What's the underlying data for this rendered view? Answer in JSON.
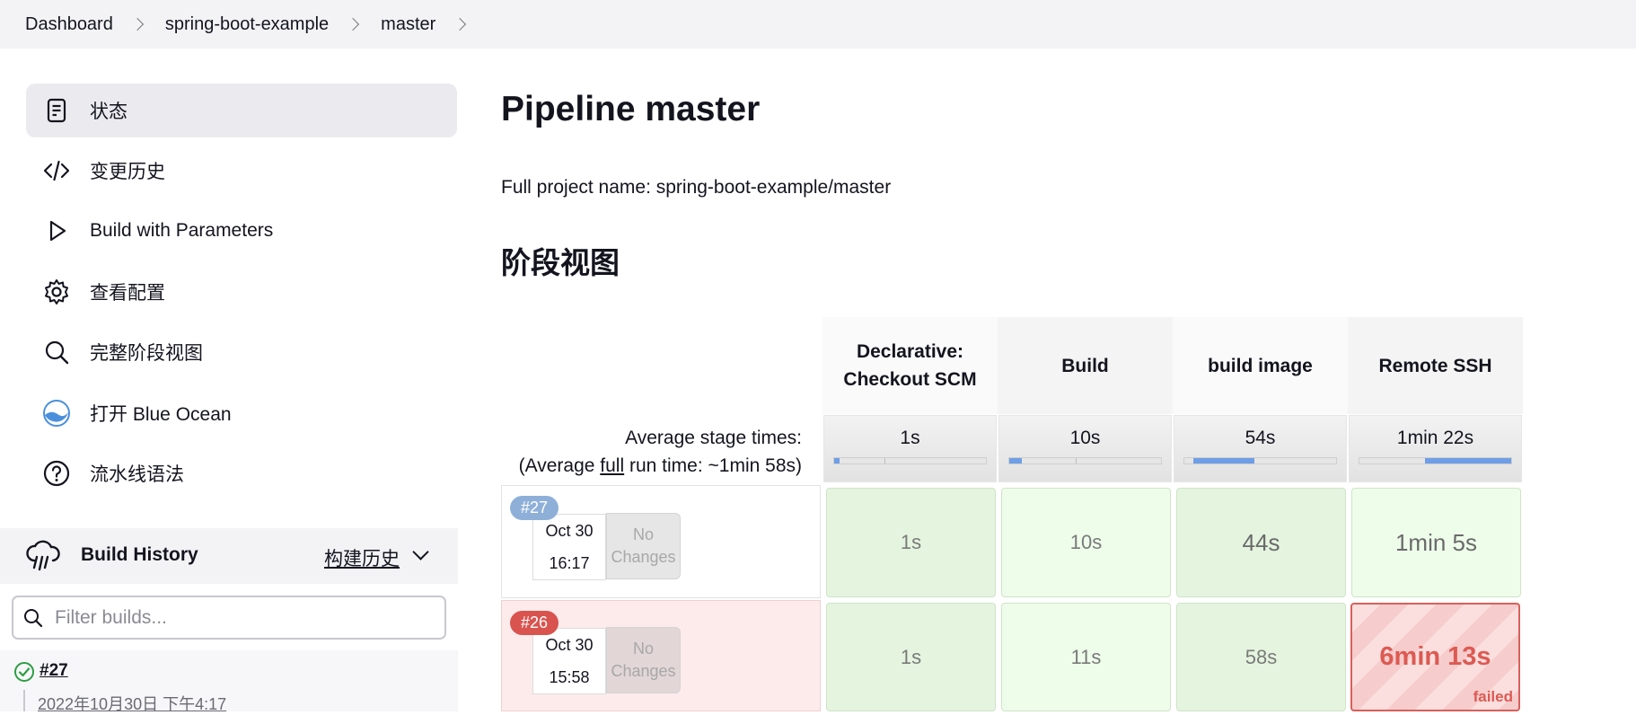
{
  "breadcrumb": [
    "Dashboard",
    "spring-boot-example",
    "master"
  ],
  "sidebar": {
    "items": [
      {
        "label": "状态",
        "icon": "status-document-icon",
        "active": true
      },
      {
        "label": "变更历史",
        "icon": "code-icon"
      },
      {
        "label": "Build with Parameters",
        "icon": "play-icon"
      },
      {
        "label": "查看配置",
        "icon": "gear-icon"
      },
      {
        "label": "完整阶段视图",
        "icon": "search-icon"
      },
      {
        "label": "打开 Blue Ocean",
        "icon": "blue-ocean-icon"
      },
      {
        "label": "流水线语法",
        "icon": "help-icon"
      }
    ]
  },
  "build_history": {
    "title": "Build History",
    "link_label": "构建历史",
    "filter_placeholder": "Filter builds...",
    "entries": [
      {
        "number": "#27",
        "date": "2022年10月30日 下午4:17",
        "status": "success"
      }
    ]
  },
  "main": {
    "title": "Pipeline master",
    "full_project_name": "Full project name: spring-boot-example/master",
    "stage_view_title": "阶段视图"
  },
  "stage_view": {
    "avg_label_line1": "Average stage times:",
    "avg_label_prefix": "(Average ",
    "avg_label_link": "full",
    "avg_label_suffix": " run time: ~1min 58s)",
    "stages": [
      {
        "name": "Declarative: Checkout SCM",
        "name_line1": "Declarative:",
        "name_line2": "Checkout SCM",
        "avg": "1s",
        "avg_fraction": 0.01
      },
      {
        "name": "Build",
        "name_line1": "Build",
        "name_line2": "",
        "avg": "10s",
        "avg_fraction": 0.08
      },
      {
        "name": "build image",
        "name_line1": "build image",
        "name_line2": "",
        "avg": "54s",
        "avg_fraction": 0.4
      },
      {
        "name": "Remote SSH",
        "name_line1": "Remote SSH",
        "name_line2": "",
        "avg": "1min 22s",
        "avg_fraction": 0.57
      }
    ],
    "runs": [
      {
        "number": "#27",
        "month_day": "Oct 30",
        "time": "16:17",
        "changes_line1": "No",
        "changes_line2": "Changes",
        "status": "success",
        "cells": [
          "1s",
          "10s",
          "44s",
          "1min 5s"
        ]
      },
      {
        "number": "#26",
        "month_day": "Oct 30",
        "time": "15:58",
        "changes_line1": "No",
        "changes_line2": "Changes",
        "status": "failed",
        "cells": [
          "1s",
          "11s",
          "58s",
          "6min 13s"
        ],
        "failed_label": "failed"
      }
    ]
  },
  "colors": {
    "accent_blue": "#6e9ee6",
    "success_bg": "#eefcea",
    "failure_red": "#dc5a52",
    "badge_blue": "#8eb0d8"
  }
}
